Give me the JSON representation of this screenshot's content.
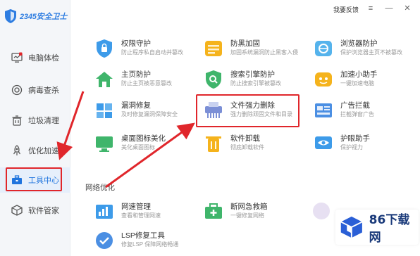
{
  "app": {
    "logo_text": "2345安全卫士"
  },
  "topbar": {
    "feedback": "我要反馈",
    "menu_icon": "menu-icon",
    "minimize": "—",
    "close": "✕"
  },
  "sidebar": {
    "items": [
      {
        "label": "电脑体检",
        "icon": "monitor-check-icon"
      },
      {
        "label": "病毒查杀",
        "icon": "virus-scan-icon"
      },
      {
        "label": "垃圾清理",
        "icon": "trash-icon"
      },
      {
        "label": "优化加速",
        "icon": "rocket-icon"
      },
      {
        "label": "工具中心",
        "icon": "toolbox-icon",
        "active": true
      },
      {
        "label": "软件管家",
        "icon": "software-box-icon"
      }
    ]
  },
  "tools": [
    {
      "name": "权限守护",
      "desc": "防止程序私自启动并篡改",
      "icon": "shield-lock-icon"
    },
    {
      "name": "防黑加固",
      "desc": "加固系统漏洞防止黑客入侵",
      "icon": "hacker-defense-icon"
    },
    {
      "name": "浏览器防护",
      "desc": "保护浏览器主页不被篡改",
      "icon": "browser-protect-icon"
    },
    {
      "name": "主页防护",
      "desc": "防止主页被恶意篡改",
      "icon": "home-protect-icon"
    },
    {
      "name": "搜索引擎防护",
      "desc": "防止搜索引擎被篡改",
      "icon": "search-protect-icon"
    },
    {
      "name": "加速小助手",
      "desc": "一键加速电脑",
      "icon": "speed-helper-icon"
    },
    {
      "name": "漏洞修复",
      "desc": "及时修复漏洞保障安全",
      "icon": "vulnerability-fix-icon"
    },
    {
      "name": "文件强力删除",
      "desc": "强力删除顽固文件和目录",
      "icon": "file-shredder-icon"
    },
    {
      "name": "广告拦截",
      "desc": "拦截弹窗广告",
      "icon": "ad-block-icon"
    },
    {
      "name": "桌面图标美化",
      "desc": "美化桌面图标",
      "icon": "desktop-beautify-icon"
    },
    {
      "name": "软件卸载",
      "desc": "彻底卸载软件",
      "icon": "uninstall-icon"
    },
    {
      "name": "护眼助手",
      "desc": "保护视力",
      "icon": "eye-care-icon"
    }
  ],
  "network_section": {
    "title": "网络优化",
    "tools": [
      {
        "name": "网速管理",
        "desc": "查看和管理网速",
        "icon": "network-speed-icon"
      },
      {
        "name": "断网急救箱",
        "desc": "一键修复网络",
        "icon": "network-firstaid-icon"
      },
      {
        "name": "LSP修复工具",
        "desc": "修复LSP 保障网络畅通",
        "icon": "lsp-repair-icon"
      }
    ]
  },
  "watermark": {
    "text": "86下载网",
    "icon": "box-logo-icon"
  },
  "colors": {
    "accent": "#1f74de",
    "highlight": "#e0262b",
    "sidebar_bg": "#f4f6f9"
  }
}
